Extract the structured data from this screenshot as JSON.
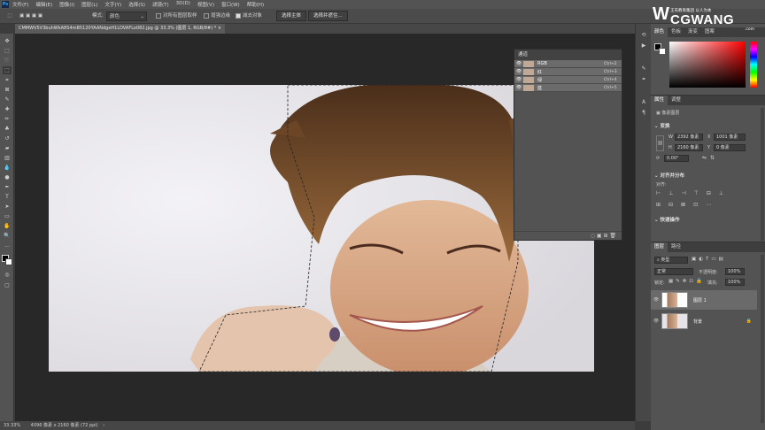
{
  "menu": {
    "logo": "Ps",
    "items": [
      "文件(F)",
      "编辑(E)",
      "图像(I)",
      "图层(L)",
      "文字(Y)",
      "选择(S)",
      "滤镜(T)",
      "3D(D)",
      "视图(V)",
      "窗口(W)",
      "帮助(H)"
    ]
  },
  "options": {
    "mode_label": "模式:",
    "mode_value": "颜色",
    "sample_all": "对所有图层取样",
    "enhance_edge": "增强边缘",
    "subtract": "减去对象",
    "select_subject": "选择主体",
    "select_mask": "选择并遮住..."
  },
  "document": {
    "tab_title": "CMMWV5V3buhWkA8S4mB5120YAANdgeH1LOVAFLo082.jpg @ 33.3% (图层 1, RGB/8#) *",
    "zoom": "33.33%",
    "doc_size": "4096 像素 x 2160 像素 (72 ppi)"
  },
  "channels": {
    "title": "通道",
    "rows": [
      {
        "name": "RGB",
        "shortcut": "Ctrl+2"
      },
      {
        "name": "红",
        "shortcut": "Ctrl+3"
      },
      {
        "name": "绿",
        "shortcut": "Ctrl+4"
      },
      {
        "name": "蓝",
        "shortcut": "Ctrl+5"
      }
    ]
  },
  "watermark": {
    "brand": "CGWANG",
    "subtitle": "王氏教育集团 以人为本",
    "domain": ".com"
  },
  "color_panel": {
    "tabs": [
      "颜色",
      "色板",
      "渐变",
      "图案"
    ]
  },
  "properties": {
    "tabs": [
      "属性",
      "调整"
    ],
    "layer_type": "像素图层",
    "transform_label": "变换",
    "w": "2392 像素",
    "h": "2160 像素",
    "x": "1001 像素",
    "y": "0 像素",
    "angle": "0.00°",
    "align_label": "对齐并分布",
    "align_sub": "对齐:",
    "quick_label": "快速操作"
  },
  "layers": {
    "tabs": [
      "图层",
      "路径"
    ],
    "kind": "类型",
    "blend": "正常",
    "opacity_label": "不透明度:",
    "opacity": "100%",
    "lock_label": "锁定:",
    "fill_label": "填充:",
    "fill": "100%",
    "items": [
      {
        "name": "图层 1"
      },
      {
        "name": "背景"
      }
    ]
  }
}
